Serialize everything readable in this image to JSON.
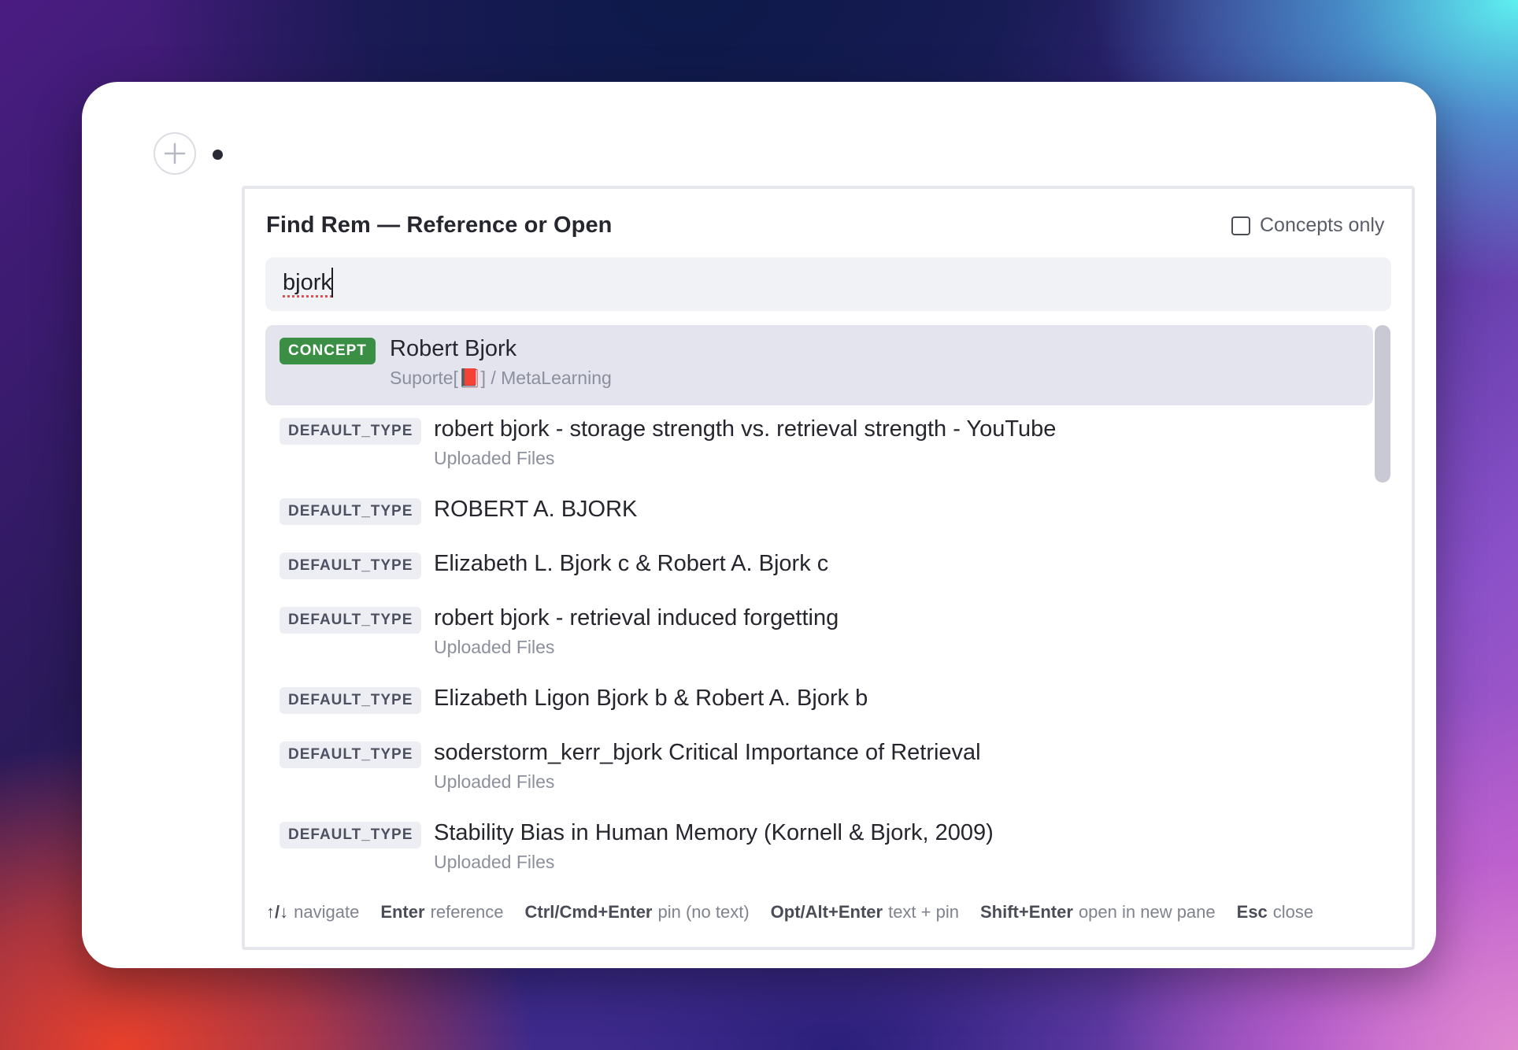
{
  "editor": {
    "add_icon": "plus-icon",
    "bullet_icon": "bullet-icon"
  },
  "dialog": {
    "title": "Find Rem — Reference or Open",
    "concepts_only_label": "Concepts only",
    "concepts_only_checked": false,
    "search": {
      "value": "bjork"
    },
    "results": [
      {
        "badge": "CONCEPT",
        "title": "Robert Bjork",
        "subtitle": "Suporte[📕] / MetaLearning",
        "selected": true
      },
      {
        "badge": "DEFAULT_TYPE",
        "title": "robert bjork - storage strength vs. retrieval strength - YouTube",
        "subtitle": "Uploaded Files"
      },
      {
        "badge": "DEFAULT_TYPE",
        "title": "ROBERT A. BJORK",
        "subtitle": ""
      },
      {
        "badge": "DEFAULT_TYPE",
        "title": "Elizabeth L. Bjork c & Robert A. Bjork c",
        "subtitle": ""
      },
      {
        "badge": "DEFAULT_TYPE",
        "title": "robert bjork - retrieval induced forgetting",
        "subtitle": "Uploaded Files"
      },
      {
        "badge": "DEFAULT_TYPE",
        "title": "Elizabeth Ligon Bjork b & Robert A. Bjork b",
        "subtitle": ""
      },
      {
        "badge": "DEFAULT_TYPE",
        "title": "soderstorm_kerr_bjork Critical Importance of Retrieval",
        "subtitle": "Uploaded Files"
      },
      {
        "badge": "DEFAULT_TYPE",
        "title": "Stability Bias in Human Memory (Kornell & Bjork, 2009)",
        "subtitle": "Uploaded Files"
      }
    ],
    "footer_hints": [
      {
        "key": "↑/↓",
        "label": "navigate"
      },
      {
        "key": "Enter",
        "label": "reference"
      },
      {
        "key": "Ctrl/Cmd+Enter",
        "label": "pin (no text)"
      },
      {
        "key": "Opt/Alt+Enter",
        "label": "text + pin"
      },
      {
        "key": "Shift+Enter",
        "label": "open in new pane"
      },
      {
        "key": "Esc",
        "label": "close"
      }
    ]
  },
  "colors": {
    "concept_badge": "#3a8f45",
    "selected_row": "#e3e4ed",
    "default_badge": "#eceef3"
  }
}
